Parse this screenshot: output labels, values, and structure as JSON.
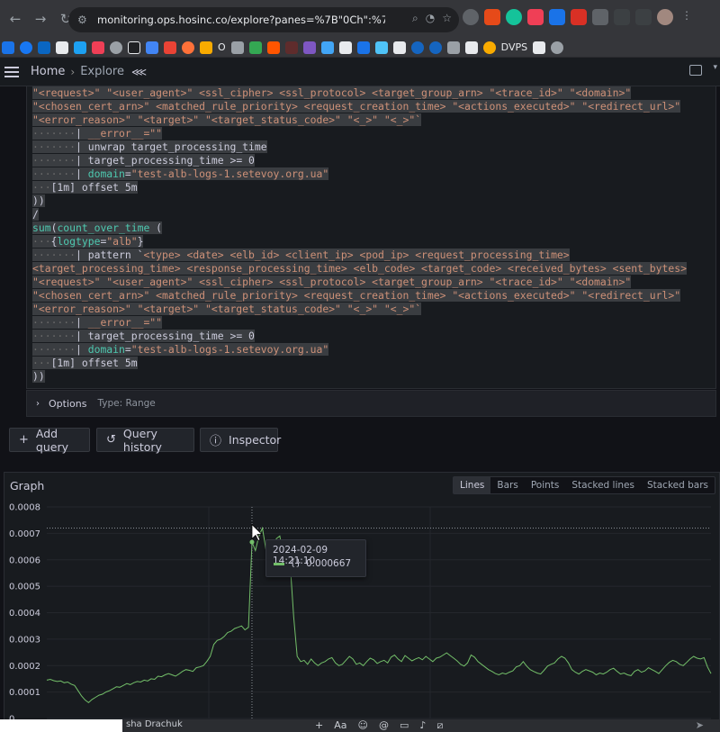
{
  "browser": {
    "url": "monitoring.ops.hosinc.co/explore?panes=%7B\"0Ch\":%7B\"datasource\":...",
    "bookmarks": {
      "label_o": "O",
      "label_dvps": "DVPS"
    }
  },
  "header": {
    "home": "Home",
    "explore": "Explore"
  },
  "query": {
    "lines": [
      [
        [
          "s",
          "\"<request>\" \"<user_agent>\" <ssl_cipher> <ssl_protocol> <target_group_arn> \"<trace_id>\" \"<domain>\""
        ]
      ],
      [
        [
          "s",
          "\"<chosen_cert_arn>\" <matched_rule_priority> <request_creation_time> \"<actions_executed>\" \"<redirect_url>\""
        ]
      ],
      [
        [
          "s",
          "\"<error_reason>\" \"<target>\" \"<target_status_code>\" \"<_>\" \"<_>\"`"
        ]
      ],
      [
        [
          "d",
          "·······"
        ],
        [
          "k",
          "| "
        ],
        [
          "s",
          "__error__=\"\""
        ]
      ],
      [
        [
          "d",
          "·······"
        ],
        [
          "k",
          "| unwrap target_processing_time"
        ]
      ],
      [
        [
          "d",
          "·······"
        ],
        [
          "k",
          "| target_processing_time >= 0"
        ]
      ],
      [
        [
          "d",
          "·······"
        ],
        [
          "k",
          "| "
        ],
        [
          "f",
          "domain"
        ],
        [
          "k",
          "="
        ],
        [
          "s",
          "\"test-alb-logs-1.setevoy.org.ua\""
        ]
      ],
      [
        [
          "d",
          "···"
        ],
        [
          "k",
          "[1m] offset 5m"
        ]
      ],
      [
        [
          "k",
          "))"
        ]
      ],
      [
        [
          "k",
          "/"
        ]
      ],
      [
        [
          "f",
          "sum"
        ],
        [
          "k",
          "("
        ],
        [
          "f",
          "count_over_time"
        ],
        [
          "k",
          " ("
        ]
      ],
      [
        [
          "d",
          "···"
        ],
        [
          "k",
          "{"
        ],
        [
          "f",
          "logtype"
        ],
        [
          "k",
          "="
        ],
        [
          "s",
          "\"alb\""
        ],
        [
          "k",
          "}"
        ]
      ],
      [
        [
          "d",
          "·······"
        ],
        [
          "k",
          "| pattern `"
        ],
        [
          "s",
          "<type> <date> <elb_id> <client_ip> <pod_ip> <request_processing_time>"
        ]
      ],
      [
        [
          "s",
          "<target_processing_time> <response_processing_time> <elb_code> <target_code> <received_bytes> <sent_bytes>"
        ]
      ],
      [
        [
          "s",
          "\"<request>\" \"<user_agent>\" <ssl_cipher> <ssl_protocol> <target_group_arn> \"<trace_id>\" \"<domain>\""
        ]
      ],
      [
        [
          "s",
          "\"<chosen_cert_arn>\" <matched_rule_priority> <request_creation_time> \"<actions_executed>\" \"<redirect_url>\""
        ]
      ],
      [
        [
          "s",
          "\"<error_reason>\" \"<target>\" \"<target_status_code>\" \"<_>\" \"<_>\"`"
        ]
      ],
      [
        [
          "d",
          "·······"
        ],
        [
          "k",
          "| "
        ],
        [
          "s",
          "__error__=\"\""
        ]
      ],
      [
        [
          "d",
          "·······"
        ],
        [
          "k",
          "| target_processing_time >= 0"
        ]
      ],
      [
        [
          "d",
          "·······"
        ],
        [
          "k",
          "| "
        ],
        [
          "f",
          "domain"
        ],
        [
          "k",
          "="
        ],
        [
          "s",
          "\"test-alb-logs-1.setevoy.org.ua\""
        ]
      ],
      [
        [
          "d",
          "···"
        ],
        [
          "k",
          "[1m] offset 5m"
        ]
      ],
      [
        [
          "k",
          "))"
        ]
      ]
    ],
    "options_label": "Options",
    "options_type": "Type: Range"
  },
  "buttons": {
    "add_query": "Add query",
    "query_history": "Query history",
    "inspector": "Inspector"
  },
  "graph": {
    "title": "Graph",
    "modes": [
      "Lines",
      "Bars",
      "Points",
      "Stacked lines",
      "Stacked bars"
    ],
    "active_mode": "Lines",
    "tooltip": {
      "time": "2024-02-09 14:21:10",
      "series": "{}",
      "value": "0.000667"
    }
  },
  "chat": {
    "name_fragment": "sha Drachuk"
  },
  "chart_data": {
    "type": "line",
    "title": "Graph",
    "xlabel": "",
    "ylabel": "",
    "ylim": [
      0,
      0.0008
    ],
    "yticks": [
      "0",
      "0.0001",
      "0.0002",
      "0.0003",
      "0.0004",
      "0.0005",
      "0.0006",
      "0.0007",
      "0.0008"
    ],
    "grid": true,
    "threshold_line": 0.00072,
    "hover_index": 59,
    "series": [
      {
        "name": "{}",
        "color": "#73bf69",
        "values": [
          0.000145,
          0.000148,
          0.000143,
          0.00014,
          0.000142,
          0.000135,
          0.000138,
          0.00013,
          0.000125,
          0.000105,
          8.5e-05,
          7e-05,
          6e-05,
          7.2e-05,
          8e-05,
          8.8e-05,
          9.2e-05,
          0.0001,
          0.000105,
          0.000112,
          0.00012,
          0.000118,
          0.000125,
          0.000132,
          0.000128,
          0.000135,
          0.00014,
          0.000138,
          0.000145,
          0.000142,
          0.00015,
          0.000148,
          0.00016,
          0.000158,
          0.000165,
          0.00017,
          0.000165,
          0.00016,
          0.000168,
          0.000178,
          0.000185,
          0.000182,
          0.000178,
          0.000192,
          0.000195,
          0.0002,
          0.000215,
          0.000235,
          0.00028,
          0.000295,
          0.0003,
          0.00031,
          0.000325,
          0.00033,
          0.00034,
          0.000345,
          0.00035,
          0.000335,
          0.000345,
          0.000667,
          0.000635,
          0.00069,
          0.00072,
          0.00064,
          0.00059,
          0.000575,
          0.00068,
          0.00069,
          0.00062,
          0.00058,
          0.00058,
          0.000385,
          0.000235,
          0.000215,
          0.00022,
          0.000205,
          0.000225,
          0.00021,
          0.0002,
          0.00021,
          0.000215,
          0.000225,
          0.00023,
          0.00021,
          0.0002,
          0.000205,
          0.00022,
          0.000235,
          0.000225,
          0.000205,
          0.00021,
          0.0002,
          0.000215,
          0.000228,
          0.000222,
          0.000208,
          0.000215,
          0.00022,
          0.00021,
          0.000232,
          0.00024,
          0.000225,
          0.000215,
          0.000238,
          0.000228,
          0.000218,
          0.000225,
          0.00023,
          0.000222,
          0.000235,
          0.000225,
          0.000215,
          0.000228,
          0.000232,
          0.00024,
          0.000248,
          0.000238,
          0.000228,
          0.000218,
          0.000205,
          0.000198,
          0.00021,
          0.00024,
          0.000232,
          0.000215,
          0.000205,
          0.000195,
          0.000185,
          0.000178,
          0.00017,
          0.000165,
          0.000172,
          0.000168,
          0.000175,
          0.00018,
          0.000195,
          0.0002,
          0.000215,
          0.000198,
          0.000185,
          0.000178,
          0.000172,
          0.000168,
          0.000182,
          0.000198,
          0.000205,
          0.00021,
          0.000225,
          0.000235,
          0.000228,
          0.00021,
          0.000185,
          0.000175,
          0.000168,
          0.000178,
          0.000185,
          0.00018,
          0.000175,
          0.000165,
          0.000172,
          0.000168,
          0.000175,
          0.000185,
          0.00019,
          0.000178,
          0.000168,
          0.000172,
          0.000165,
          0.000162,
          0.000178,
          0.000185,
          0.000175,
          0.00018,
          0.000192,
          0.000185,
          0.000178,
          0.00017,
          0.000185,
          0.0002,
          0.000212,
          0.00022,
          0.000215,
          0.000205,
          0.0002,
          0.000212,
          0.000225,
          0.000235,
          0.000228,
          0.000225,
          0.00023,
          0.000195,
          0.00017
        ]
      }
    ]
  }
}
